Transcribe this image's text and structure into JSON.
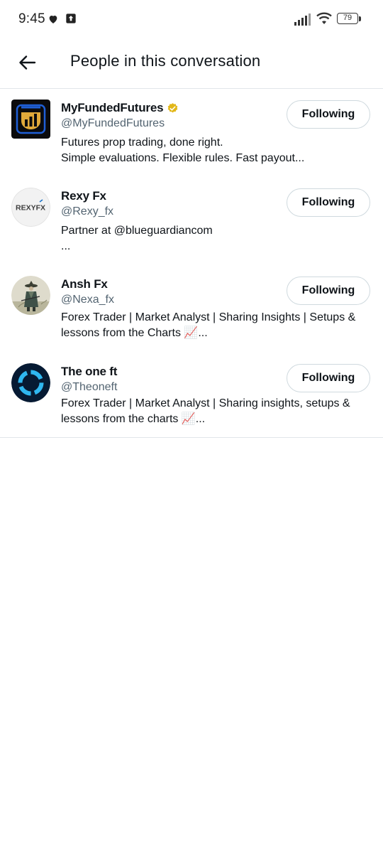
{
  "status_bar": {
    "time": "9:45",
    "battery": "79",
    "icons": [
      "heart-icon",
      "upload-icon",
      "signal-icon",
      "wifi-icon",
      "battery-icon"
    ]
  },
  "header": {
    "back_icon": "arrow-left-icon",
    "title": "People in this conversation"
  },
  "users": [
    {
      "name": "MyFundedFutures",
      "verified": true,
      "handle": "@MyFundedFutures",
      "bio_line1": "Futures prop trading, done right.",
      "bio_line2": "Simple evaluations. Flexible rules. Fast payout...",
      "button": "Following",
      "avatar_initials": ""
    },
    {
      "name": "Rexy Fx",
      "verified": false,
      "handle": "@Rexy_fx",
      "bio_line1": "Partner at @blueguardiancom",
      "bio_line2": "...",
      "button": "Following",
      "avatar_initials": "REXYFX"
    },
    {
      "name": "Ansh Fx",
      "verified": false,
      "handle": "@Nexa_fx",
      "bio_line1": "Forex Trader | Market Analyst | Sharing Insights | Setups &",
      "bio_line2": "lessons from the Charts 📈...",
      "button": "Following",
      "avatar_initials": ""
    },
    {
      "name": "The one ft",
      "verified": false,
      "handle": "@Theoneft",
      "bio_line1": "Forex Trader | Market Analyst | Sharing insights, setups &",
      "bio_line2": "lessons from the charts 📈...",
      "button": "Following",
      "avatar_initials": ""
    }
  ],
  "colors": {
    "text_primary": "#0f1419",
    "text_secondary": "#536471",
    "border": "#cfd9de",
    "divider": "#e1e6ea",
    "verified_gold": "#e2b719"
  }
}
